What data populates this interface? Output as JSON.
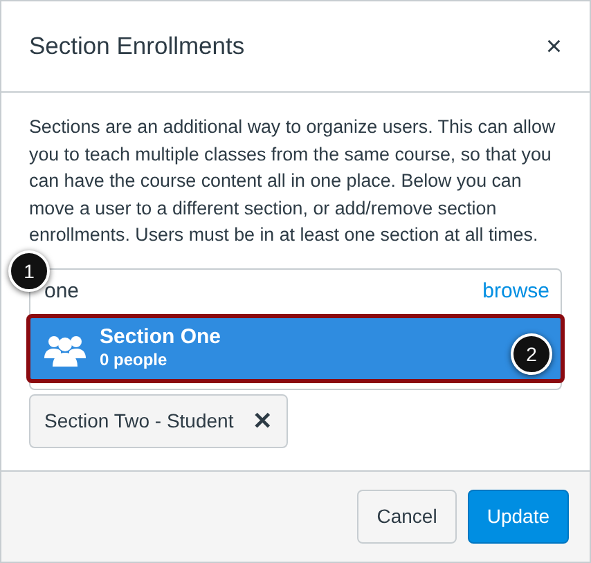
{
  "dialog": {
    "title": "Section Enrollments",
    "close": "×"
  },
  "description": "Sections are an additional way to organize users. This can allow you to teach multiple classes from the same course, so that you can have the course content all in one place. Below you can move a user to a different section, or add/remove section enrollments. Users must be in at least one section at all times.",
  "search": {
    "value": "one",
    "browse": "browse"
  },
  "results": [
    {
      "name": "Section One",
      "count": "0 people",
      "selected": true,
      "outlined": true
    }
  ],
  "enrollments": [
    {
      "label": "Section Two - Student",
      "remove": "✕"
    }
  ],
  "callouts": [
    "1",
    "2"
  ],
  "buttons": [
    {
      "label": "Cancel",
      "kind": "secondary"
    },
    {
      "label": "Update",
      "kind": "primary"
    }
  ]
}
